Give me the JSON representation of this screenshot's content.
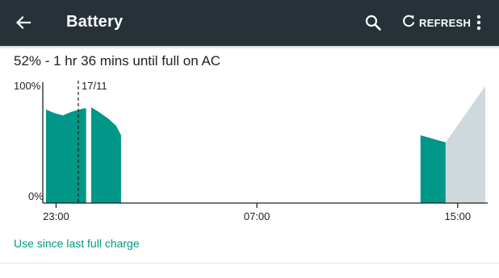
{
  "toolbar": {
    "title": "Battery",
    "refresh_label": "REFRESH",
    "icons": [
      "back-arrow-icon",
      "search-icon",
      "refresh-icon",
      "overflow-menu-icon"
    ]
  },
  "status_text": "52% - 1 hr 36 mins until full on AC",
  "link_text": "Use since last full charge",
  "colors": {
    "toolbar_bg": "#263238",
    "usage_fill": "#009688",
    "prediction_fill": "#cfd8dc",
    "link": "#009688"
  },
  "chart_data": {
    "type": "area",
    "y_labels": [
      "100%",
      "0%"
    ],
    "x_tick_labels": [
      "23:00",
      "07:00",
      "15:00"
    ],
    "day_marker_label": "17/11",
    "ylim": [
      0,
      100
    ],
    "xlim": [
      0,
      17.5
    ],
    "series": [
      {
        "kind": "usage",
        "x": [
          0,
          0.33,
          0.67,
          1.0,
          1.33,
          1.5,
          1.6
        ],
        "values": [
          80,
          77,
          75,
          78,
          80,
          81,
          81
        ]
      },
      {
        "kind": "usage",
        "x": [
          1.8,
          2.1,
          2.5,
          2.8,
          2.99
        ],
        "values": [
          82,
          78,
          72,
          66,
          58
        ]
      },
      {
        "kind": "usage",
        "x": [
          14.92,
          15.25,
          15.58,
          15.92
        ],
        "values": [
          58,
          56,
          54,
          52
        ]
      },
      {
        "kind": "prediction",
        "x": [
          15.92,
          17.5
        ],
        "values": [
          52,
          100
        ]
      }
    ]
  }
}
